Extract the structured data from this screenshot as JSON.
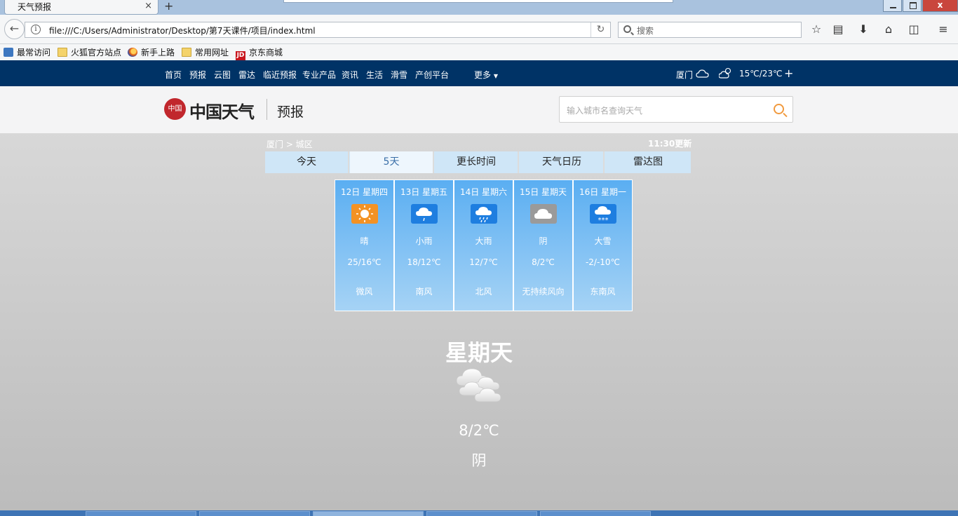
{
  "browser": {
    "tab_title": "天气预报",
    "tab_close": "×",
    "new_tab": "+",
    "window_close": "x",
    "url": "file:///C:/Users/Administrator/Desktop/第7天课件/项目/index.html",
    "search_placeholder": "搜索",
    "reload": "↻",
    "info": "i",
    "back": "←"
  },
  "bookmarks": [
    {
      "label": "最常访问",
      "icon": "most-visited-icon"
    },
    {
      "label": "火狐官方站点",
      "icon": "folder-icon"
    },
    {
      "label": "新手上路",
      "icon": "firefox-icon"
    },
    {
      "label": "常用网址",
      "icon": "folder-icon"
    },
    {
      "label": "京东商城",
      "icon": "jd-icon",
      "badge": "JD"
    }
  ],
  "site_nav": {
    "items": [
      "首页",
      "预报",
      "云图",
      "雷达",
      "临近预报",
      "专业产品",
      "资讯",
      "生活",
      "滑雪",
      "产创平台"
    ],
    "more": "更多",
    "city": "厦门",
    "temp": "15℃/23℃",
    "add": "+"
  },
  "header": {
    "logo_text": "中国天气",
    "logo_seal": "中国",
    "subtitle": "预报",
    "search_placeholder": "输入城市名查询天气"
  },
  "breadcrumb": "厦门 > 城区",
  "updated": "11:30更新",
  "view_tabs": [
    {
      "label": "今天",
      "active": false
    },
    {
      "label": "5天",
      "active": true
    },
    {
      "label": "更长时间",
      "active": false
    },
    {
      "label": "天气日历",
      "active": false
    },
    {
      "label": "雷达图",
      "active": false
    }
  ],
  "forecast": [
    {
      "date": "12日 星期四",
      "weather": "晴",
      "temp": "25/16℃",
      "wind": "微风",
      "icon": "sunny-icon",
      "color": "#f39224"
    },
    {
      "date": "13日 星期五",
      "weather": "小雨",
      "temp": "18/12℃",
      "wind": "南风",
      "icon": "light-rain-icon",
      "color": "#1e7ee0"
    },
    {
      "date": "14日 星期六",
      "weather": "大雨",
      "temp": "12/7℃",
      "wind": "北风",
      "icon": "heavy-rain-icon",
      "color": "#1e7ee0"
    },
    {
      "date": "15日 星期天",
      "weather": "阴",
      "temp": "8/2℃",
      "wind": "无持续风向",
      "icon": "overcast-icon",
      "color": "#9a9a9a"
    },
    {
      "date": "16日 星期一",
      "weather": "大雪",
      "temp": "-2/-10℃",
      "wind": "东南风",
      "icon": "heavy-snow-icon",
      "color": "#1e7ee0"
    }
  ],
  "selected": {
    "day": "星期天",
    "temp": "8/2℃",
    "weather": "阴",
    "icon": "overcast-clouds-icon"
  },
  "colors": {
    "topbar": "#003366",
    "accent": "#f19a3e",
    "card": "#5aaef2"
  }
}
